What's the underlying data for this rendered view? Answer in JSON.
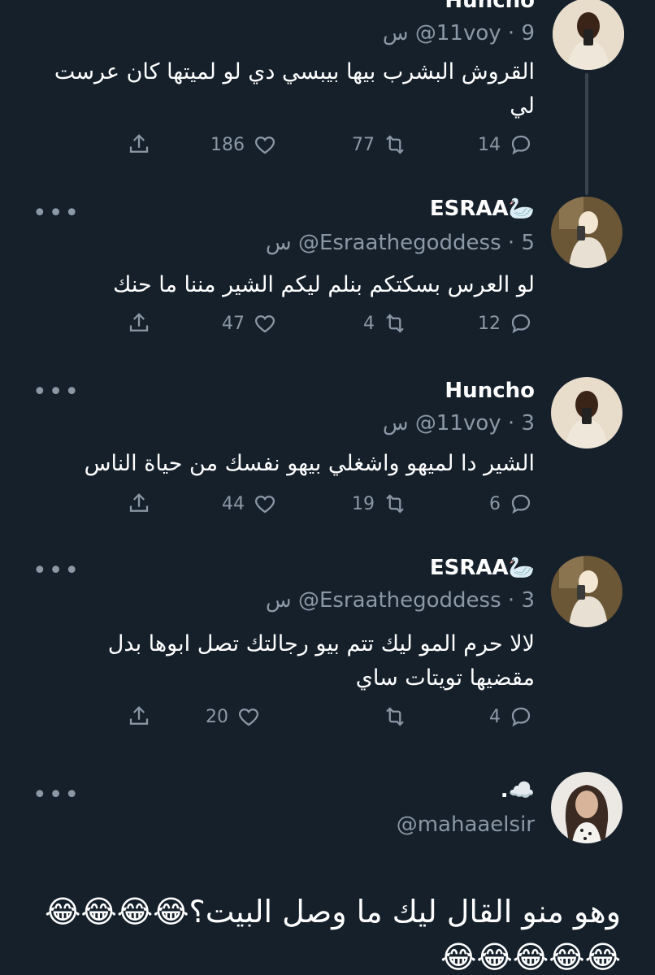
{
  "tweets": [
    {
      "name": "Huncho",
      "handle": "@11voy",
      "time": "9 س",
      "text": "القروش البشرب بيها بيبسي دي لو لميتها كان عرست لي",
      "replies": "14",
      "retweets": "77",
      "likes": "186"
    },
    {
      "name": "ESRAA🦢",
      "handle": "@Esraathegoddess",
      "time": "5 س",
      "text": "لو العرس بسكتكم بنلم ليكم الشير مننا ما حنك",
      "replies": "12",
      "retweets": "4",
      "likes": "47"
    },
    {
      "name": "Huncho",
      "handle": "@11voy",
      "time": "3 س",
      "text": "الشير دا لميهو واشغلي بيهو نفسك من حياة الناس",
      "replies": "6",
      "retweets": "19",
      "likes": "44"
    },
    {
      "name": "ESRAA🦢",
      "handle": "@Esraathegoddess",
      "time": "3 س",
      "text": "لالا حرم المو ليك تتم بيو رجالتك تصل ابوها بدل مقضيها تويتات ساي",
      "replies": "4",
      "retweets": "",
      "likes": "20"
    }
  ],
  "author": {
    "name": ".☁️",
    "handle": "@mahaaelsir"
  },
  "main_text": "وهو منو القال ليك ما وصل البيت؟😂😂😂😂😂😂😂😂😂",
  "more_label": "•••",
  "colors": {
    "background": "#15202b",
    "muted": "#8b98a5",
    "thread_line": "#38444d"
  },
  "icons": [
    "reply-icon",
    "retweet-icon",
    "like-icon",
    "share-icon",
    "more-icon"
  ]
}
